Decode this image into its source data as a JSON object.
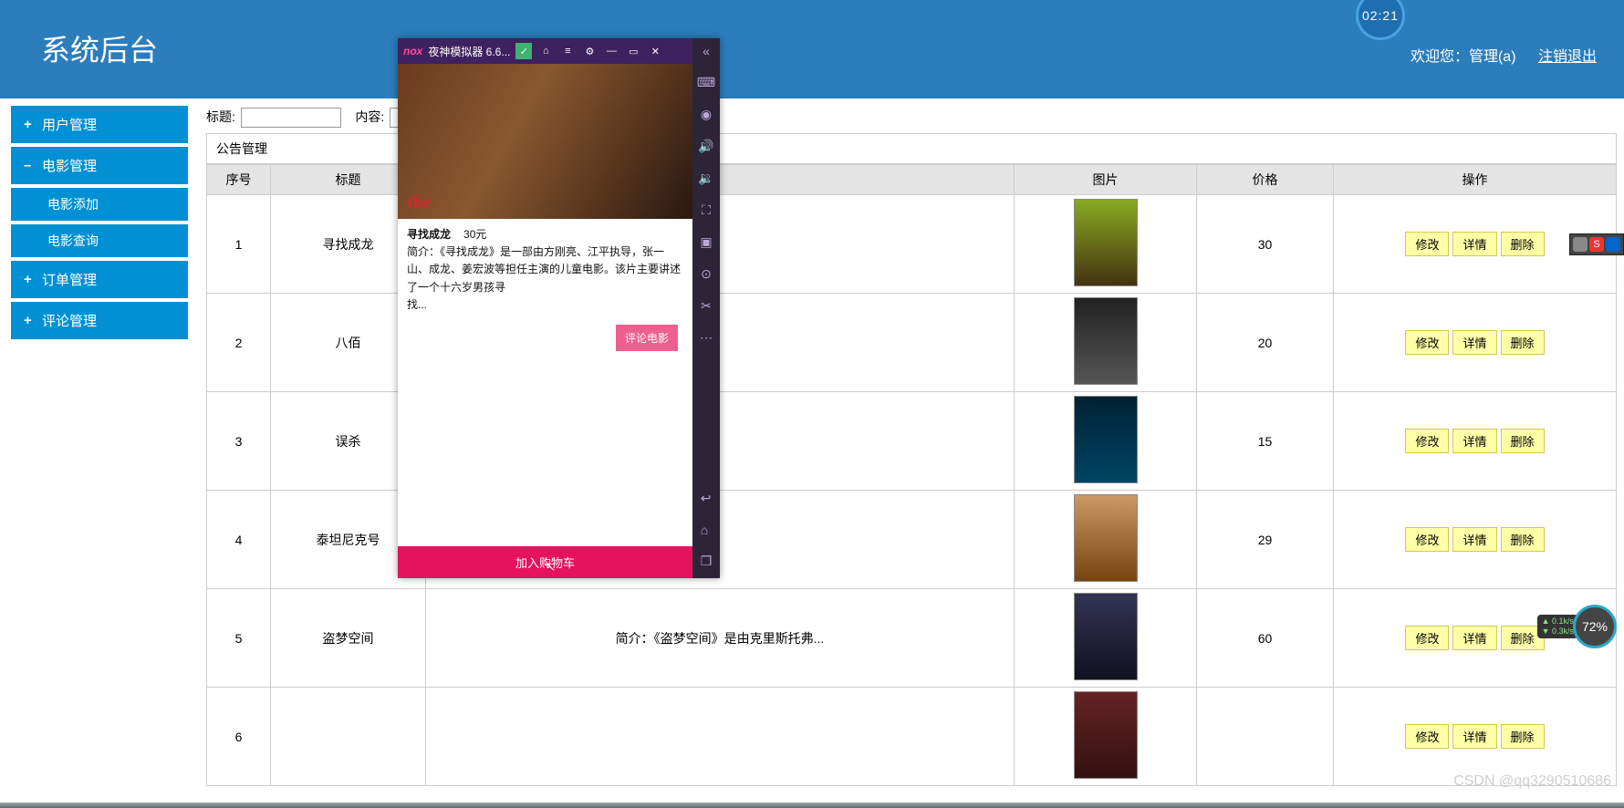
{
  "header": {
    "title": "系统后台",
    "welcome": "欢迎您：管理(a)",
    "logout": "注销退出",
    "clock": "02:21"
  },
  "sidebar": {
    "items": [
      {
        "sym": "+",
        "label": "用户管理"
      },
      {
        "sym": "–",
        "label": "电影管理"
      },
      {
        "sym": "+",
        "label": "订单管理"
      },
      {
        "sym": "+",
        "label": "评论管理"
      }
    ],
    "subs": [
      {
        "label": "电影添加"
      },
      {
        "label": "电影查询"
      }
    ]
  },
  "filter": {
    "title_label": "标题:",
    "content_label": "内容:"
  },
  "panel": {
    "title": "公告管理"
  },
  "table": {
    "headers": [
      "序号",
      "标题",
      "",
      "图片",
      "价格",
      "操作"
    ],
    "ops": {
      "edit": "修改",
      "detail": "详情",
      "delete": "删除"
    },
    "rows": [
      {
        "idx": "1",
        "title": "寻找成龙",
        "desc": "",
        "price": "30",
        "poster": "p1"
      },
      {
        "idx": "2",
        "title": "八佰",
        "desc": "",
        "price": "20",
        "poster": "p2"
      },
      {
        "idx": "3",
        "title": "误杀",
        "desc": "",
        "price": "15",
        "poster": "p3"
      },
      {
        "idx": "4",
        "title": "泰坦尼克号",
        "desc": "",
        "price": "29",
        "poster": "p4"
      },
      {
        "idx": "5",
        "title": "盗梦空间",
        "desc": "简介：《盗梦空间》是由克里斯托弗...",
        "price": "60",
        "poster": "p5"
      },
      {
        "idx": "6",
        "title": "",
        "desc": "",
        "price": "",
        "poster": "p6"
      }
    ]
  },
  "emulator": {
    "app_name": "夜神模拟器 6.6...",
    "movie_title": "寻找成龙",
    "price_text": "30元",
    "intro": "简介：《寻找成龙》是一部由方刚亮、江平执导，张一山、成龙、姜宏波等担任主演的儿童电影。该片主要讲述了一个十六岁男孩寻",
    "more": "找...",
    "review_btn": "评论电影",
    "cart_btn": "加入购物车",
    "hero_title": "the"
  },
  "perf": {
    "line1": "0.1k/s",
    "line2": "0.3k/s",
    "pct": "72%"
  },
  "watermark": "CSDN @qq3290510686"
}
